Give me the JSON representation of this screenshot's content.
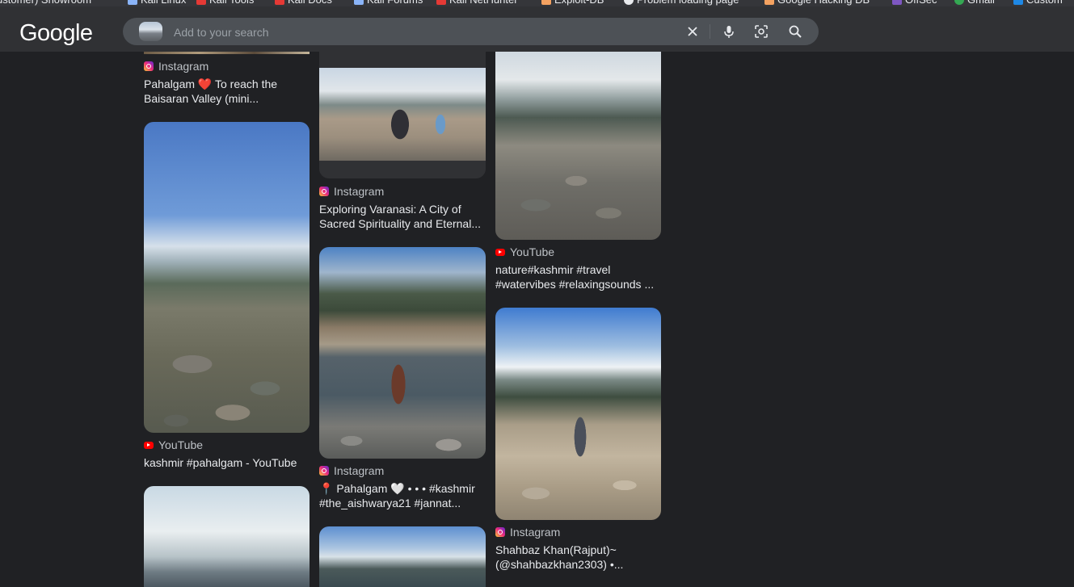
{
  "bookmarks": [
    {
      "label": "ustomer) Showroom"
    },
    {
      "label": "Kali Linux"
    },
    {
      "label": "Kali Tools"
    },
    {
      "label": "Kali Docs"
    },
    {
      "label": "Kali Forums"
    },
    {
      "label": "Kali NetHunter"
    },
    {
      "label": "Exploit-DB"
    },
    {
      "label": "Problem loading page"
    },
    {
      "label": "Google Hacking DB"
    },
    {
      "label": "OffSec"
    },
    {
      "label": "Gmail"
    },
    {
      "label": "Custom"
    }
  ],
  "header": {
    "logo": "Google",
    "search_placeholder": "Add to your search",
    "icons": [
      "clear-icon",
      "microphone-icon",
      "lens-icon",
      "search-icon"
    ]
  },
  "results": [
    {
      "source": "Instagram",
      "source_icon": "instagram-icon",
      "title_lines": [
        "Pahalgam ❤️ To reach the",
        "Baisaran Valley (mini..."
      ]
    },
    {
      "source": "Instagram",
      "source_icon": "instagram-icon",
      "title_lines": [
        "Exploring Varanasi: A City of",
        "Sacred Spirituality and Eternal..."
      ]
    },
    {
      "source": "YouTube",
      "source_icon": "youtube-icon",
      "title_lines": [
        "nature#kashmir #travel",
        "#watervibes #relaxingsounds ..."
      ]
    },
    {
      "source": "YouTube",
      "source_icon": "youtube-icon",
      "title_lines": [
        "kashmir #pahalgam - YouTube"
      ]
    },
    {
      "source": "Instagram",
      "source_icon": "instagram-icon",
      "title_lines": [
        "📍 Pahalgam 🤍 • • • #kashmir",
        "#the_aishwarya21 #jannat..."
      ]
    },
    {
      "source": "Instagram",
      "source_icon": "instagram-icon",
      "title_lines": [
        "Shahbaz Khan(Rajput)~",
        "(@shahbazkhan2303) •..."
      ]
    }
  ],
  "colors": {
    "page_bg": "#202124",
    "header_bg": "#303134",
    "searchbox_bg": "#4d5156",
    "text": "#e8eaed",
    "source_text": "#bdc1c6"
  }
}
